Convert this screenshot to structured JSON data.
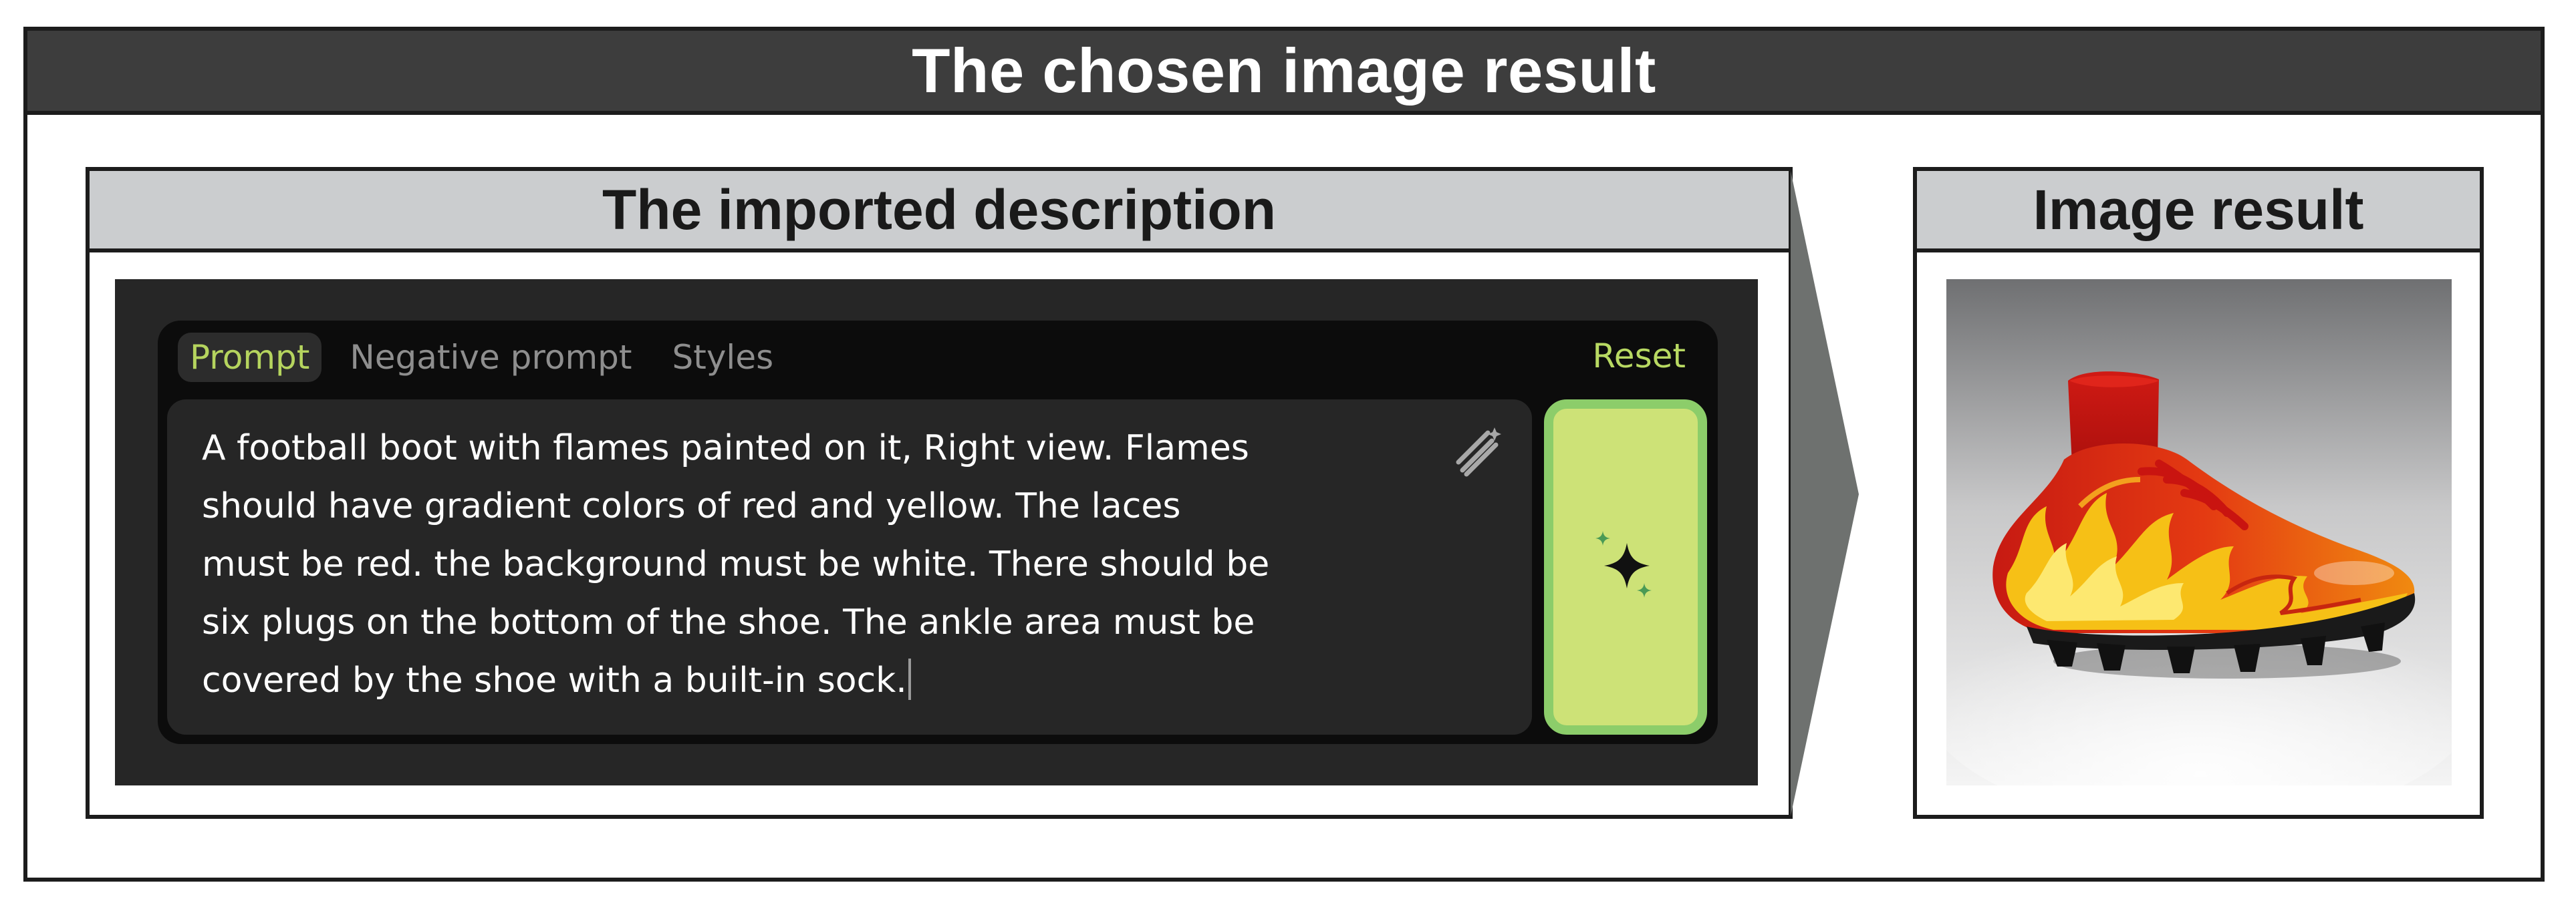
{
  "outer": {
    "title": "The chosen image result"
  },
  "description_panel": {
    "title": "The imported description",
    "tabs": [
      {
        "label": "Prompt",
        "active": true
      },
      {
        "label": "Negative prompt",
        "active": false
      },
      {
        "label": "Styles",
        "active": false
      }
    ],
    "reset_label": "Reset",
    "prompt_text": "A football boot with flames painted on it, Right view. Flames\nshould have gradient colors of red and yellow. The laces\nmust be red. the background must be white. There should be\nsix plugs on the bottom of the shoe. The ankle area must be\ncovered by the shoe with a built-in sock.",
    "icons": {
      "enhance": "magic-wand-icon",
      "generate": "sparkle-icon"
    },
    "colors": {
      "accent": "#b5d45e",
      "button": "#cde277",
      "button_border": "#8ccd6a",
      "panel_bg": "#262626"
    }
  },
  "image_panel": {
    "title": "Image result",
    "image_subject": "red-and-yellow-flame-football-boot"
  }
}
